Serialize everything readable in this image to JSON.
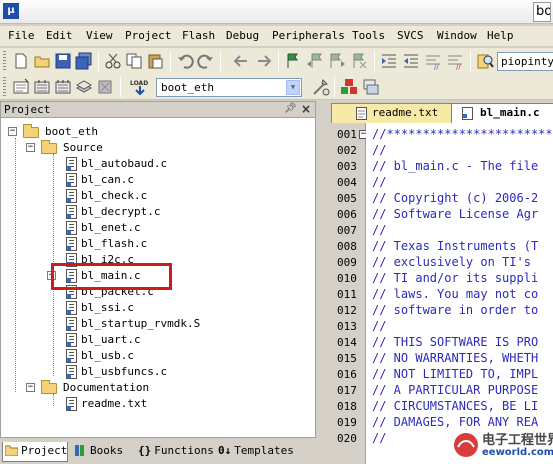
{
  "window": {
    "title_visible": "bo"
  },
  "menu": [
    "File",
    "Edit",
    "View",
    "Project",
    "Flash",
    "Debug",
    "Peripherals",
    "Tools",
    "SVCS",
    "Window",
    "Help"
  ],
  "toolbar": {
    "file_input_value": "piopintyp",
    "target_select": "boot_eth",
    "load_label": "LOAD"
  },
  "project_panel": {
    "title": "Project",
    "tree": [
      {
        "label": "boot_eth",
        "type": "root"
      },
      {
        "label": "Source",
        "type": "folder"
      },
      {
        "label": "bl_autobaud.c",
        "type": "file"
      },
      {
        "label": "bl_can.c",
        "type": "file"
      },
      {
        "label": "bl_check.c",
        "type": "file"
      },
      {
        "label": "bl_decrypt.c",
        "type": "file"
      },
      {
        "label": "bl_enet.c",
        "type": "file"
      },
      {
        "label": "bl_flash.c",
        "type": "file"
      },
      {
        "label": "bl_i2c.c",
        "type": "file"
      },
      {
        "label": "bl_main.c",
        "type": "file",
        "highlighted": true
      },
      {
        "label": "bl_packet.c",
        "type": "file"
      },
      {
        "label": "bl_ssi.c",
        "type": "file"
      },
      {
        "label": "bl_startup_rvmdk.S",
        "type": "file"
      },
      {
        "label": "bl_uart.c",
        "type": "file"
      },
      {
        "label": "bl_usb.c",
        "type": "file"
      },
      {
        "label": "bl_usbfuncs.c",
        "type": "file"
      },
      {
        "label": "Documentation",
        "type": "folder"
      },
      {
        "label": "readme.txt",
        "type": "file"
      }
    ]
  },
  "bottom_tabs": [
    "Project",
    "Books",
    "Functions",
    "Templates"
  ],
  "editor": {
    "tabs": [
      {
        "label": "readme.txt",
        "active": false
      },
      {
        "label": "bl_main.c",
        "active": true
      }
    ],
    "lines": [
      {
        "n": "001",
        "text": "//*******************************"
      },
      {
        "n": "002",
        "text": "//"
      },
      {
        "n": "003",
        "text": "// bl_main.c - The file"
      },
      {
        "n": "004",
        "text": "//"
      },
      {
        "n": "005",
        "text": "// Copyright (c) 2006-2"
      },
      {
        "n": "006",
        "text": "// Software License Agr"
      },
      {
        "n": "007",
        "text": "//"
      },
      {
        "n": "008",
        "text": "// Texas Instruments (T"
      },
      {
        "n": "009",
        "text": "// exclusively on TI's"
      },
      {
        "n": "010",
        "text": "// TI and/or its suppli"
      },
      {
        "n": "011",
        "text": "// laws. You may not co"
      },
      {
        "n": "012",
        "text": "// software in order to"
      },
      {
        "n": "013",
        "text": "//"
      },
      {
        "n": "014",
        "text": "// THIS SOFTWARE IS PRO"
      },
      {
        "n": "015",
        "text": "// NO WARRANTIES, WHETH"
      },
      {
        "n": "016",
        "text": "// NOT LIMITED TO, IMPL"
      },
      {
        "n": "017",
        "text": "// A PARTICULAR PURPOSE"
      },
      {
        "n": "018",
        "text": "// CIRCUMSTANCES, BE LI"
      },
      {
        "n": "019",
        "text": "// DAMAGES, FOR ANY REA"
      },
      {
        "n": "020",
        "text": "//"
      }
    ]
  },
  "watermark": {
    "cn": "电子工程世界",
    "en": "eeworld.com.cn"
  },
  "colors": {
    "code_comment": "#2b2bbd",
    "highlight": "#d11a1a",
    "menu_bg": "#ece9d8",
    "chrome_bg": "#d4d0c8"
  }
}
